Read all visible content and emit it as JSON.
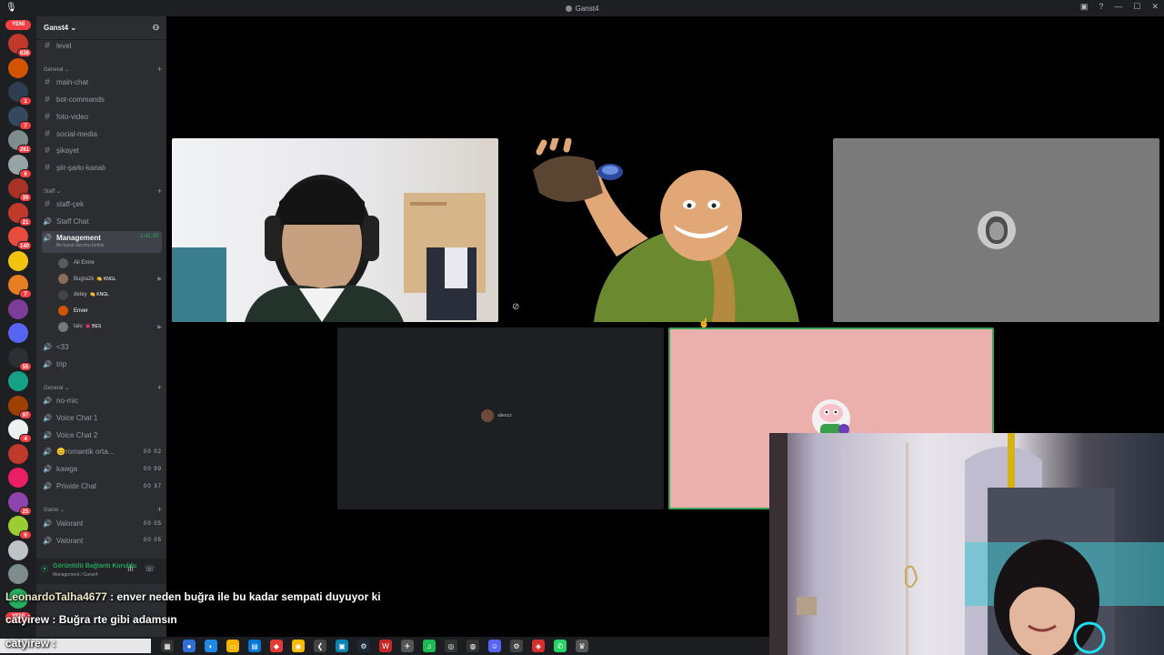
{
  "window": {
    "title": "Ganst4",
    "controls": [
      "▣",
      "?",
      "—",
      "☐",
      "✕"
    ]
  },
  "server_rail": {
    "top_badge": "YENİ",
    "bottom_badge": "YENİ",
    "servers": [
      {
        "color": "#c0392b",
        "badge": "636"
      },
      {
        "color": "#d35400",
        "badge": ""
      },
      {
        "color": "#2c3e50",
        "badge": "1"
      },
      {
        "color": "#34495e",
        "badge": "7"
      },
      {
        "color": "#7f8c8d",
        "badge": "261"
      },
      {
        "color": "#95a5a6",
        "badge": "6"
      },
      {
        "color": "#a93226",
        "badge": "39"
      },
      {
        "color": "#c0392b",
        "badge": "21"
      },
      {
        "color": "#e74c3c",
        "badge": "140"
      },
      {
        "color": "#f1c40f",
        "badge": ""
      },
      {
        "color": "#e67e22",
        "badge": "7"
      },
      {
        "color": "#7d3c98",
        "badge": ""
      },
      {
        "color": "#5865f2",
        "badge": ""
      },
      {
        "color": "#2c2f33",
        "badge": "55"
      },
      {
        "color": "#16a085",
        "badge": ""
      },
      {
        "color": "#a04000",
        "badge": "97"
      },
      {
        "color": "#ecf0f1",
        "badge": "4"
      },
      {
        "color": "#c0392b",
        "badge": ""
      },
      {
        "color": "#e91e63",
        "badge": ""
      },
      {
        "color": "#8e44ad",
        "badge": "25"
      },
      {
        "color": "#9acd32",
        "badge": "6"
      },
      {
        "color": "#bdc3c7",
        "badge": ""
      },
      {
        "color": "#7f8c8d",
        "badge": ""
      },
      {
        "color": "#27ae60",
        "badge": ""
      }
    ]
  },
  "sidebar": {
    "server_name": "Ganst4",
    "top_channel": "level",
    "categories": {
      "general1": "General",
      "staff": "Staff",
      "general2": "General",
      "game": "Game"
    },
    "general_channels": [
      "main-chat",
      "bot-commands",
      "foto-video",
      "social-media",
      "şikayet",
      "şiir-şarkı-kanalı"
    ],
    "staff_channels": [
      "staff-çek",
      "Staff Chat"
    ],
    "active_voice": {
      "name": "Management",
      "timer": "2:41:39",
      "status": "Bir kanal durumu belirle"
    },
    "members": [
      {
        "name": "Ali Emre",
        "tag": "",
        "color": "#5a5a5a"
      },
      {
        "name": "Bugra2k",
        "tag": "🍋 KNGL",
        "color": "#8a6d5b"
      },
      {
        "name": "detey",
        "tag": "🍋 KNGL",
        "color": "#444"
      },
      {
        "name": "Enver",
        "tag": "",
        "color": "#d35400"
      },
      {
        "name": "talu",
        "tag": "💗 BES",
        "color": "#777"
      }
    ],
    "voice_channels_a": [
      "<33",
      "trip"
    ],
    "voice_channels_b": [
      {
        "name": "no-mic",
        "count": ""
      },
      {
        "name": "Voice Chat 1",
        "count": ""
      },
      {
        "name": "Voice Chat 2",
        "count": ""
      },
      {
        "name": "😊romantik orta...",
        "count": "00 02"
      },
      {
        "name": "kawga",
        "count": "00 99"
      },
      {
        "name": "Private Chat",
        "count": "00 37"
      }
    ],
    "game_channels": [
      {
        "name": "Valorant",
        "count": "00 05"
      },
      {
        "name": "Valorant",
        "count": "00 05"
      }
    ],
    "voice_status": {
      "title": "Görüntülü Bağlantı Kuruldu",
      "subtitle": "Management / Ganst4"
    }
  },
  "tiles": {
    "dark_tile_label": "alienzz"
  },
  "chat_overlay": [
    {
      "user": "LeonardoTalha4677",
      "message": " : enver neden buğra ile bu kadar sempati duyuyor ki"
    },
    {
      "user": "catyirew",
      "message": " : Buğra rte gibi adamsın"
    },
    {
      "user": "catyirew",
      "message": " :"
    }
  ],
  "colors": {
    "accent": "#5865f2",
    "online": "#23a55a",
    "alert": "#f23f43"
  }
}
